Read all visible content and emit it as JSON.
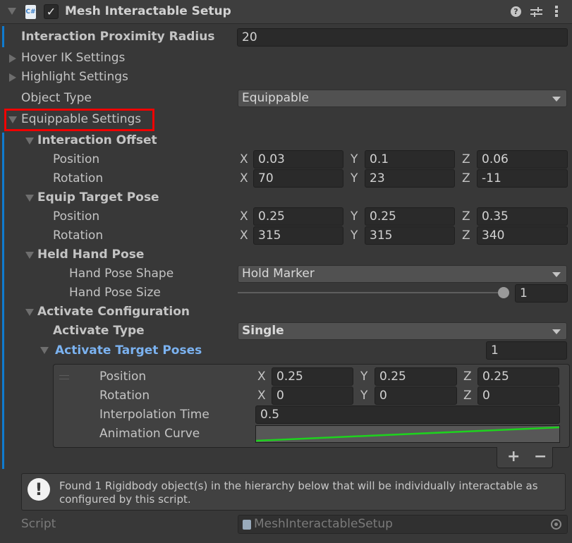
{
  "header": {
    "title": "Mesh Interactable Setup",
    "enabled": true,
    "script_icon": "csharp-script-icon",
    "icons": [
      "help-icon",
      "preset-icon",
      "kebab-menu-icon"
    ]
  },
  "fields": {
    "proximity_radius": {
      "label": "Interaction Proximity Radius",
      "value": "20"
    },
    "hover_ik": {
      "label": "Hover IK Settings",
      "expanded": false
    },
    "highlight": {
      "label": "Highlight Settings",
      "expanded": false
    },
    "object_type": {
      "label": "Object Type",
      "value": "Equippable"
    },
    "equippable": {
      "label": "Equippable Settings",
      "expanded": true
    }
  },
  "interaction_offset": {
    "label": "Interaction Offset",
    "position": {
      "label": "Position",
      "x": "0.03",
      "y": "0.1",
      "z": "0.06"
    },
    "rotation": {
      "label": "Rotation",
      "x": "70",
      "y": "23",
      "z": "-11"
    }
  },
  "equip_target_pose": {
    "label": "Equip Target Pose",
    "position": {
      "label": "Position",
      "x": "0.25",
      "y": "0.25",
      "z": "0.35"
    },
    "rotation": {
      "label": "Rotation",
      "x": "315",
      "y": "315",
      "z": "340"
    }
  },
  "held_hand_pose": {
    "label": "Held Hand Pose",
    "shape": {
      "label": "Hand Pose Shape",
      "value": "Hold Marker"
    },
    "size": {
      "label": "Hand Pose Size",
      "value": "1",
      "slider_fraction": 1.0
    }
  },
  "activate_config": {
    "label": "Activate Configuration",
    "type": {
      "label": "Activate Type",
      "value": "Single"
    },
    "target_poses": {
      "label": "Activate Target Poses",
      "count": "1",
      "items": [
        {
          "position": {
            "label": "Position",
            "x": "0.25",
            "y": "0.25",
            "z": "0.25"
          },
          "rotation": {
            "label": "Rotation",
            "x": "0",
            "y": "0",
            "z": "0"
          },
          "interpolation": {
            "label": "Interpolation Time",
            "value": "0.5"
          },
          "curve": {
            "label": "Animation Curve",
            "color": "#1ed21e",
            "start": 0.0,
            "end": 1.0
          }
        }
      ],
      "add_label": "+",
      "remove_label": "−"
    }
  },
  "axes": {
    "x": "X",
    "y": "Y",
    "z": "Z"
  },
  "help_message": "Found 1 Rigidbody object(s) in the hierarchy below that will be individually interactable as configured by this script.",
  "script": {
    "label": "Script",
    "value": "MeshInteractableSetup"
  },
  "colors": {
    "accent_bar": "#0f7bd0",
    "highlight_box": "#f00000",
    "link_blue": "#7bb2f0"
  }
}
